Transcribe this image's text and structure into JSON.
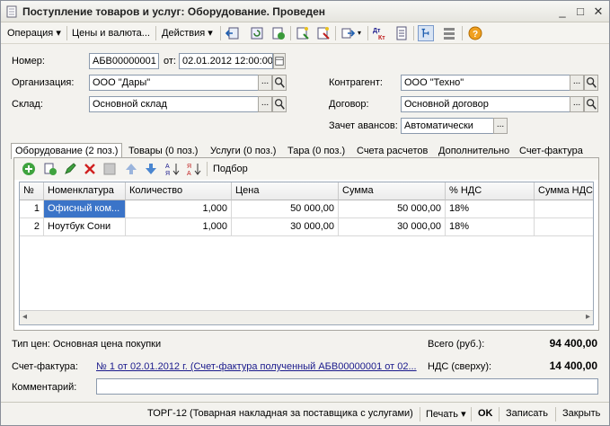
{
  "window": {
    "title": "Поступление товаров и услуг: Оборудование. Проведен",
    "min": "_",
    "max": "□",
    "close": "✕"
  },
  "toolbar": {
    "operation": "Операция ▾",
    "prices": "Цены и валюта...",
    "actions": "Действия ▾"
  },
  "form": {
    "number_label": "Номер:",
    "number": "АБВ00000001",
    "date_label": "от:",
    "date": "02.01.2012 12:00:00",
    "org_label": "Организация:",
    "org": "ООО \"Дары\"",
    "warehouse_label": "Склад:",
    "warehouse": "Основной склад",
    "contractor_label": "Контрагент:",
    "contractor": "ООО \"Техно\"",
    "contract_label": "Договор:",
    "contract": "Основной договор",
    "advance_label": "Зачет авансов:",
    "advance": "Автоматически",
    "select_btn": "...",
    "open_btn": "🔍"
  },
  "tabs": [
    "Оборудование (2 поз.)",
    "Товары (0 поз.)",
    "Услуги (0 поз.)",
    "Тара (0 поз.)",
    "Счета расчетов",
    "Дополнительно",
    "Счет-фактура"
  ],
  "table_toolbar": {
    "pick": "Подбор"
  },
  "table": {
    "headers": [
      "№",
      "Номенклатура",
      "Количество",
      "Цена",
      "Сумма",
      "% НДС",
      "Сумма НДС"
    ],
    "rows": [
      [
        "1",
        "Офисный ком...",
        "1,000",
        "50 000,00",
        "50 000,00",
        "18%",
        ""
      ],
      [
        "2",
        "Ноутбук Сони",
        "1,000",
        "30 000,00",
        "30 000,00",
        "18%",
        ""
      ]
    ]
  },
  "footer": {
    "price_type": "Тип цен: Основная цена покупки",
    "total_label": "Всего (руб.):",
    "total": "94 400,00",
    "invoice_label": "Счет-фактура:",
    "invoice": "№ 1 от 02.01.2012 г. (Счет-фактура полученный АБВ00000001 от 02...",
    "vat_label": "НДС (сверху):",
    "vat": "14 400,00",
    "comment_label": "Комментарий:",
    "comment": ""
  },
  "bottom": {
    "torg": "ТОРГ-12 (Товарная накладная за поставщика с услугами)",
    "print": "Печать ▾",
    "ok": "OK",
    "save": "Записать",
    "close": "Закрыть"
  }
}
